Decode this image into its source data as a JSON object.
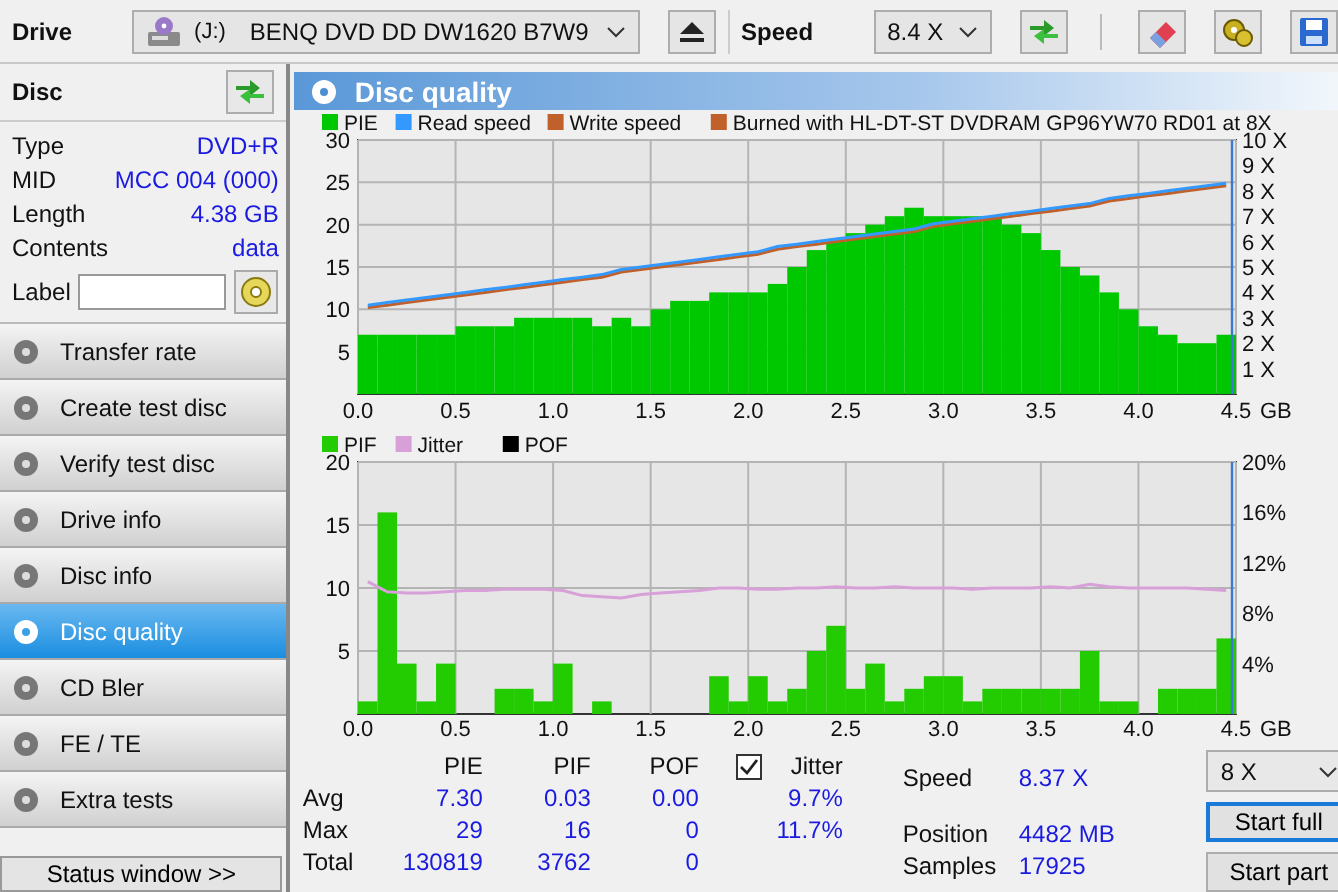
{
  "toolbar": {
    "drive_label": "Drive",
    "drive_letter": "(J:)",
    "drive_name": "BENQ DVD DD DW1620 B7W9",
    "speed_label": "Speed",
    "speed": "8.4 X"
  },
  "disc": {
    "title": "Disc",
    "info": [
      {
        "label": "Type",
        "value": "DVD+R"
      },
      {
        "label": "MID",
        "value": "MCC 004 (000)"
      },
      {
        "label": "Length",
        "value": "4.38 GB"
      },
      {
        "label": "Contents",
        "value": "data"
      }
    ],
    "label_field": "Label"
  },
  "nav": [
    {
      "label": "Transfer rate",
      "selected": false
    },
    {
      "label": "Create test disc",
      "selected": false
    },
    {
      "label": "Verify test disc",
      "selected": false
    },
    {
      "label": "Drive info",
      "selected": false
    },
    {
      "label": "Disc info",
      "selected": false
    },
    {
      "label": "Disc quality",
      "selected": true
    },
    {
      "label": "CD Bler",
      "selected": false
    },
    {
      "label": "FE / TE",
      "selected": false
    },
    {
      "label": "Extra tests",
      "selected": false
    }
  ],
  "status_button": "Status window >>",
  "panel": {
    "title": "Disc quality"
  },
  "charts": [
    {
      "chart_data": {
        "type": "bar",
        "xlabel": "GB",
        "legend": true,
        "x": [
          0.05,
          0.15,
          0.25,
          0.35,
          0.45,
          0.55,
          0.65,
          0.75,
          0.85,
          0.95,
          1.05,
          1.15,
          1.25,
          1.35,
          1.45,
          1.55,
          1.65,
          1.75,
          1.85,
          1.95,
          2.05,
          2.15,
          2.25,
          2.35,
          2.45,
          2.55,
          2.65,
          2.75,
          2.85,
          2.95,
          3.05,
          3.15,
          3.25,
          3.35,
          3.45,
          3.55,
          3.65,
          3.75,
          3.85,
          3.95,
          4.05,
          4.15,
          4.25,
          4.35,
          4.45
        ],
        "xlim": [
          0,
          4.5
        ],
        "ylim": [
          0,
          30
        ],
        "y2lim": [
          0,
          10
        ],
        "grid": true,
        "xticks": [
          {
            "value": 0,
            "label": "0.0"
          },
          {
            "value": 0.5,
            "label": "0.5"
          },
          {
            "value": 1,
            "label": "1.0"
          },
          {
            "value": 1.5,
            "label": "1.5"
          },
          {
            "value": 2,
            "label": "2.0"
          },
          {
            "value": 2.5,
            "label": "2.5"
          },
          {
            "value": 3,
            "label": "3.0"
          },
          {
            "value": 3.5,
            "label": "3.5"
          },
          {
            "value": 4,
            "label": "4.0"
          },
          {
            "value": 4.5,
            "label": "4.5"
          }
        ],
        "yticks": [
          5,
          10,
          15,
          20,
          25,
          30
        ],
        "y2ticks": [
          {
            "value": 1,
            "label": "1 X"
          },
          {
            "value": 2,
            "label": "2 X"
          },
          {
            "value": 3,
            "label": "3 X"
          },
          {
            "value": 4,
            "label": "4 X"
          },
          {
            "value": 5,
            "label": "5 X"
          },
          {
            "value": 6,
            "label": "6 X"
          },
          {
            "value": 7,
            "label": "7 X"
          },
          {
            "value": 8,
            "label": "8 X"
          },
          {
            "value": 9,
            "label": "9 X"
          },
          {
            "value": 10,
            "label": "10 X"
          }
        ],
        "series": [
          {
            "name": "PIE",
            "color": "#00c800",
            "values": [
              7,
              7,
              7,
              7,
              7,
              8,
              8,
              8,
              9,
              9,
              9,
              9,
              8,
              9,
              8,
              10,
              11,
              11,
              12,
              12,
              12,
              13,
              15,
              17,
              18,
              19,
              20,
              21,
              22,
              21,
              21,
              21,
              21,
              20,
              19,
              17,
              15,
              14,
              12,
              10,
              8,
              7,
              6,
              6,
              7
            ]
          },
          {
            "name": "Read speed",
            "type": "line",
            "axis": "y2",
            "color": "#3399ff",
            "values": [
              3.5,
              3.6,
              3.7,
              3.8,
              3.9,
              4.0,
              4.1,
              4.2,
              4.3,
              4.4,
              4.5,
              4.6,
              4.7,
              4.9,
              5.0,
              5.1,
              5.2,
              5.3,
              5.4,
              5.5,
              5.6,
              5.8,
              5.9,
              6.0,
              6.1,
              6.2,
              6.3,
              6.4,
              6.5,
              6.7,
              6.8,
              6.9,
              7.0,
              7.1,
              7.2,
              7.3,
              7.4,
              7.5,
              7.7,
              7.8,
              7.9,
              8.0,
              8.1,
              8.2,
              8.3
            ]
          },
          {
            "name": "Write speed",
            "type": "line",
            "axis": "y2",
            "color": "#c0602a",
            "values": [
              3.4,
              3.5,
              3.6,
              3.7,
              3.8,
              3.9,
              4.0,
              4.1,
              4.2,
              4.3,
              4.4,
              4.5,
              4.6,
              4.8,
              4.9,
              5.0,
              5.1,
              5.2,
              5.3,
              5.4,
              5.5,
              5.7,
              5.8,
              5.9,
              6.0,
              6.1,
              6.2,
              6.3,
              6.4,
              6.6,
              6.7,
              6.8,
              6.9,
              7.0,
              7.1,
              7.2,
              7.3,
              7.4,
              7.6,
              7.7,
              7.8,
              7.9,
              8.0,
              8.1,
              8.2
            ]
          }
        ],
        "annotations": [
          {
            "text": "Burned with HL-DT-ST DVDRAM GP96YW70 RD01 at 8X"
          }
        ]
      }
    },
    {
      "chart_data": {
        "type": "bar",
        "xlabel": "GB",
        "legend": true,
        "x": [
          0.05,
          0.15,
          0.25,
          0.35,
          0.45,
          0.55,
          0.65,
          0.75,
          0.85,
          0.95,
          1.05,
          1.15,
          1.25,
          1.35,
          1.45,
          1.55,
          1.65,
          1.75,
          1.85,
          1.95,
          2.05,
          2.15,
          2.25,
          2.35,
          2.45,
          2.55,
          2.65,
          2.75,
          2.85,
          2.95,
          3.05,
          3.15,
          3.25,
          3.35,
          3.45,
          3.55,
          3.65,
          3.75,
          3.85,
          3.95,
          4.05,
          4.15,
          4.25,
          4.35,
          4.45
        ],
        "xlim": [
          0,
          4.5
        ],
        "ylim": [
          0,
          20
        ],
        "y2lim": [
          0,
          20
        ],
        "grid": true,
        "xticks": [
          {
            "value": 0,
            "label": "0.0"
          },
          {
            "value": 0.5,
            "label": "0.5"
          },
          {
            "value": 1,
            "label": "1.0"
          },
          {
            "value": 1.5,
            "label": "1.5"
          },
          {
            "value": 2,
            "label": "2.0"
          },
          {
            "value": 2.5,
            "label": "2.5"
          },
          {
            "value": 3,
            "label": "3.0"
          },
          {
            "value": 3.5,
            "label": "3.5"
          },
          {
            "value": 4,
            "label": "4.0"
          },
          {
            "value": 4.5,
            "label": "4.5"
          }
        ],
        "yticks": [
          5,
          10,
          15,
          20
        ],
        "y2ticks": [
          {
            "value": 4,
            "label": "4%"
          },
          {
            "value": 8,
            "label": "8%"
          },
          {
            "value": 12,
            "label": "12%"
          },
          {
            "value": 16,
            "label": "16%"
          },
          {
            "value": 20,
            "label": "20%"
          }
        ],
        "series": [
          {
            "name": "PIF",
            "color": "#22cc00",
            "values": [
              1,
              16,
              4,
              1,
              4,
              0,
              0,
              2,
              2,
              1,
              4,
              0,
              1,
              0,
              0,
              0,
              0,
              0,
              3,
              1,
              3,
              1,
              2,
              5,
              7,
              2,
              4,
              1,
              2,
              3,
              3,
              1,
              2,
              2,
              2,
              2,
              2,
              5,
              1,
              1,
              0,
              2,
              2,
              2,
              6
            ]
          },
          {
            "name": "Jitter",
            "type": "line",
            "axis": "y2",
            "color": "#d8a0d8",
            "values": [
              10.5,
              9.7,
              9.6,
              9.6,
              9.7,
              9.8,
              9.8,
              9.9,
              9.9,
              9.9,
              9.8,
              9.4,
              9.3,
              9.2,
              9.5,
              9.6,
              9.7,
              9.8,
              10.0,
              10.0,
              9.9,
              9.9,
              10.0,
              10.0,
              10.1,
              10.0,
              10.0,
              10.1,
              10.0,
              10.0,
              10.0,
              9.9,
              10.0,
              10.0,
              10.0,
              10.1,
              10.0,
              10.3,
              10.1,
              10.0,
              10.0,
              10.0,
              10.0,
              9.9,
              9.8
            ]
          },
          {
            "name": "POF",
            "color": "#000000",
            "values": [
              0,
              0,
              0,
              0,
              0,
              0,
              0,
              0,
              0,
              0,
              0,
              0,
              0,
              0,
              0,
              0,
              0,
              0,
              0,
              0,
              0,
              0,
              0,
              0,
              0,
              0,
              0,
              0,
              0,
              0,
              0,
              0,
              0,
              0,
              0,
              0,
              0,
              0,
              0,
              0,
              0,
              0,
              0,
              0,
              0
            ]
          }
        ]
      }
    }
  ],
  "stats": {
    "columns": [
      "PIE",
      "PIF",
      "POF"
    ],
    "jitter": {
      "label": "Jitter",
      "checked": true
    },
    "rows": [
      {
        "label": "Avg",
        "values": [
          "7.30",
          "0.03",
          "0.00",
          "9.7%"
        ]
      },
      {
        "label": "Max",
        "values": [
          "29",
          "16",
          "0",
          "11.7%"
        ]
      },
      {
        "label": "Total",
        "values": [
          "130819",
          "3762",
          "0"
        ]
      }
    ]
  },
  "readouts": [
    {
      "label": "Speed",
      "value": "8.37 X"
    },
    {
      "label": "Position",
      "value": "4482 MB"
    },
    {
      "label": "Samples",
      "value": "17925"
    }
  ],
  "test_speed": "8 X",
  "buttons": [
    {
      "label": "Start full",
      "focused": true
    },
    {
      "label": "Start part",
      "focused": false
    }
  ]
}
